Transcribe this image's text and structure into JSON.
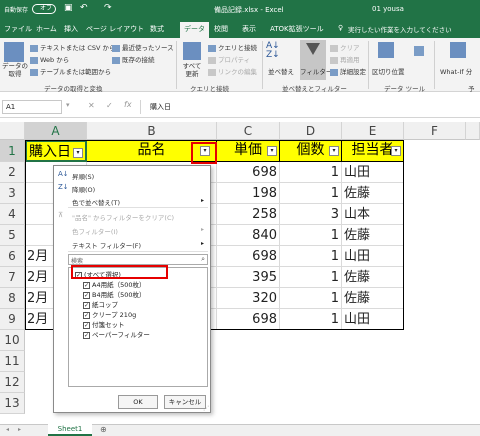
{
  "titlebar": {
    "autosave": "自動保存",
    "autosave_state": "オフ",
    "filename": "備品記録.xlsx - Excel",
    "user": "01 yousa"
  },
  "menu": [
    "ファイル",
    "ホーム",
    "挿入",
    "ページ レイアウト",
    "数式",
    "データ",
    "校閲",
    "表示",
    "ATOK拡張ツール"
  ],
  "tell_me": "実行したい作業を入力してください",
  "ribbon": {
    "get_data": "データの\n取得",
    "get_items": [
      "テキストまたは CSV から",
      "Web から",
      "テーブルまたは範囲から"
    ],
    "recent_items": [
      "最近使ったソース",
      "既存の接続"
    ],
    "group1": "データの取得と変換",
    "refresh_all": "すべて\n更新",
    "query_items": [
      "クエリと接続",
      "プロパティ",
      "リンクの編集"
    ],
    "group2": "クエリと接続",
    "sort": "並べ替え",
    "filter": "フィルター",
    "filter_items": [
      "クリア",
      "再適用",
      "詳細設定"
    ],
    "group3": "並べ替えとフィルター",
    "text_to_col": "区切り位置",
    "group4": "データ ツール",
    "whatif": "What-If 分",
    "group5": "予"
  },
  "namebox": "A1",
  "formula": "購入日",
  "columns": [
    "A",
    "B",
    "C",
    "D",
    "E",
    "F"
  ],
  "rows": [
    "1",
    "2",
    "3",
    "4",
    "5",
    "6",
    "7",
    "8",
    "9",
    "10",
    "11",
    "12",
    "13"
  ],
  "headers": {
    "a": "購入日",
    "b": "品名",
    "c": "単価",
    "d": "個数",
    "e": "担当者"
  },
  "data_rows": [
    {
      "a": "2",
      "c": "698",
      "d": "1",
      "e": "山田"
    },
    {
      "a": "2",
      "c": "198",
      "d": "1",
      "e": "佐藤"
    },
    {
      "a": "2",
      "c": "258",
      "d": "3",
      "e": "山本"
    },
    {
      "a": "2",
      "c": "840",
      "d": "1",
      "e": "佐藤"
    },
    {
      "a": "2月",
      "c": "698",
      "d": "1",
      "e": "山田"
    },
    {
      "a": "2月",
      "c": "395",
      "d": "1",
      "e": "佐藤"
    },
    {
      "a": "2月",
      "c": "320",
      "d": "1",
      "e": "佐藤"
    },
    {
      "a": "2月",
      "c": "698",
      "d": "1",
      "e": "山田"
    }
  ],
  "filter_panel": {
    "sort_asc": "昇順(S)",
    "sort_desc": "降順(O)",
    "sort_color": "色で並べ替え(T)",
    "clear": "\"品名\" からフィルターをクリア(C)",
    "color_filter": "色フィルター(I)",
    "text_filter": "テキスト フィルター(F)",
    "search_placeholder": "検索",
    "items": [
      "(すべて選択)",
      "A4用紙（500枚）",
      "B4用紙（500枚）",
      "紙コップ",
      "クリープ 210g",
      "付箋セット",
      "ペーパーフィルター"
    ],
    "ok": "OK",
    "cancel": "キャンセル"
  },
  "sheet_tab": "Sheet1",
  "colors": {
    "excel_green": "#217346",
    "highlight_red": "#e60000",
    "header_yellow": "#ffff00"
  }
}
